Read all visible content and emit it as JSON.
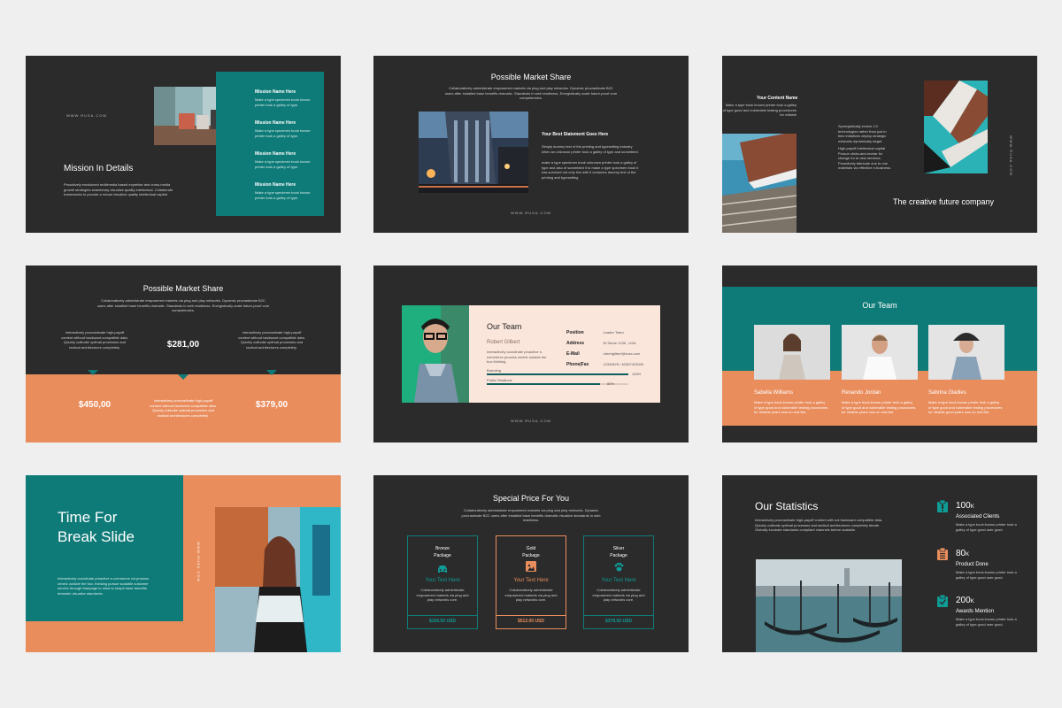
{
  "colors": {
    "background": "#efefef",
    "slide": "#2b2b2b",
    "teal": "#0f7b78",
    "orange": "#e98d5d",
    "peach": "#fbe6dc"
  },
  "brand": "WWW.RUSA.COM",
  "s1": {
    "title": "Mission In Details",
    "body": "Proactively envisioned multimedia based expertise and cross-media growth strategies seamlessly visualize quality intellectual. Collaborate frameworks to provide a robust visualize quality intellectual capital.",
    "items": [
      {
        "title": "Mission Name Here",
        "text": "Make a type specimen book known printer took a galley of type."
      },
      {
        "title": "Mission Name Here",
        "text": "Make a type specimen book known printer took a galley of type."
      },
      {
        "title": "Mission Name Here",
        "text": "Make a type specimen book known printer took a galley of type."
      },
      {
        "title": "Mission Name Here",
        "text": "Make a type specimen book known printer took a galley of type."
      }
    ]
  },
  "s2": {
    "title": "Possible Market Share",
    "intro": "Collaboratively administrate empowered markets via plug and play networks. Dynamic procrastinate B2C users after installed base benefits dramatic. Standards in web readiness. Energistically scale future-proof core competencies.",
    "heading": "Your Best Statement Goes Here",
    "p1": "Simply dummy text of the printing and typesetting industry when an unknown printer took a galley of type and scrambled.",
    "p2": "make a type specimen book unknown printer took a galley of type and also of scrambled it to make a type specimen book it has survived not only five with it centuries dummy text of the printing and typesetting"
  },
  "s3": {
    "title": "Your Content Name",
    "text": "Make a type book known printer took a galley of type good and vulnerable testing procedures for reliable",
    "p1": "Synergistically evolve 2.0 technologies rather than just in time initiatives deploy strategic networks dynamically target.",
    "p2": "High-payoff intellectual capital Pursue clicks-and-mortar for change for to new services. Proactively fabricate one to one materials via effective e-business.",
    "tagline": "The creative future company"
  },
  "s4": {
    "title": "Possible Market Share",
    "intro": "Collaboratively administrate empowered markets via plug and play networks. Dynamic procrastinate B2C users after installed base benefits dramatic. Standards in web readiness. Energistically scale future-proof core competencies.",
    "col_text": "Interactively procrastinate high-payoff content without backward compatible data. Quickly cultivate optimal processes and tactical architectures completely.",
    "v_center": "$281,00",
    "v_left": "$450,00",
    "v_right": "$379,00"
  },
  "s5": {
    "title": "Our Team",
    "name": "Robert Gilbert",
    "desc": "Interactively coordinate proactive e-commerce process centric outside the box thinking.",
    "fields": [
      {
        "label": "Position",
        "value": "Leader Team"
      },
      {
        "label": "Address",
        "value": "W Shore 1235 , USA"
      },
      {
        "label": "E-Mail",
        "value": "robertgilbert@rusa.com"
      },
      {
        "label": "Phone|Fax",
        "value": "12345678 / 62367423000"
      }
    ],
    "bars": [
      {
        "label": "Branding",
        "pct": "100%",
        "fill": 1.0
      },
      {
        "label": "Public Relations",
        "pct": "80%",
        "fill": 0.8
      }
    ]
  },
  "s6": {
    "title": "Our Team",
    "members": [
      {
        "name": "Sabella Williams",
        "text": "Make a type book known printer took a galley of type good and vulnerable testing procedures for reliable years now on real flat."
      },
      {
        "name": "Renando Jordan",
        "text": "Make a type book known printer took a galley of type good and vulnerable testing procedures for reliable years now on real flat."
      },
      {
        "name": "Sabrina Gladies",
        "text": "Make a type book known printer took a galley of type good and vulnerable testing procedures for reliable good years now on real flat."
      }
    ]
  },
  "s7": {
    "title_l1": "Time For",
    "title_l2": "Break Slide",
    "body": "Interactively coordinate proactive e-commerce via process centric outside the box. thinking pursue scalable customer service through thanpage to mind to shape base benefits dramatic visualize standards."
  },
  "s8": {
    "title": "Special Price For You",
    "intro": "Collaboratively administrate empowered markets via plug and play networks. Dynamic procrastinate B2C users after installed base benefits dramatic visualize standards in web readiness.",
    "cards": [
      {
        "name1": "Bronze",
        "name2": "Package",
        "icon": "car-icon",
        "sub": "Your Text Here",
        "text": "Collaboratively administrate empowered markets via plug and play networks core.",
        "price": "$156.00 USD"
      },
      {
        "name1": "Gold",
        "name2": "Package",
        "icon": "image-icon",
        "sub": "Your Text Here",
        "text": "Collaboratively administrate empowered markets via plug and play networks core.",
        "price": "$512.00 USD"
      },
      {
        "name1": "Silver",
        "name2": "Package",
        "icon": "paw-icon",
        "sub": "Your Text Here",
        "text": "Collaboratively administrate empowered markets via plug and play networks core.",
        "price": "$378.00 USD"
      }
    ]
  },
  "s9": {
    "title": "Our Statistics",
    "intro": "Interactively procrastinate high-payoff content with out backward compatible data. Quickly cultivate optimal processes and tactical architectures completely iterate. Globally incubate standards compliant channels before scalable.",
    "stats": [
      {
        "num": "100",
        "unit": "K",
        "label": "Associated Clients",
        "text": "Make a type book known printer took a galley of type good user good."
      },
      {
        "num": "80",
        "unit": "K",
        "label": "Product Done",
        "text": "Make a type book known printer took a galley of type good user good."
      },
      {
        "num": "200",
        "unit": "K",
        "label": "Awards Mention",
        "text": "Make a type book known printer took a galley of type good user good."
      }
    ]
  }
}
